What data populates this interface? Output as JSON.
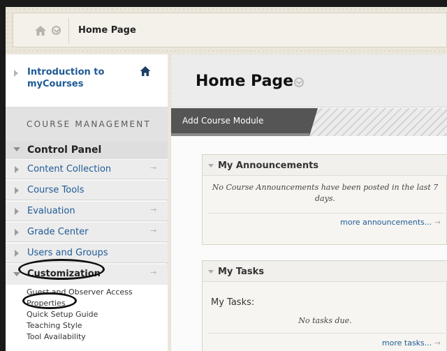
{
  "breadcrumb": {
    "current": "Home Page"
  },
  "menu": {
    "course_title": "Introduction to myCourses",
    "section_header": "COURSE MANAGEMENT",
    "control_panel": "Control Panel",
    "items": [
      {
        "label": "Content Collection",
        "arrow": "→"
      },
      {
        "label": "Course Tools",
        "arrow": ""
      },
      {
        "label": "Evaluation",
        "arrow": "→"
      },
      {
        "label": "Grade Center",
        "arrow": "→"
      },
      {
        "label": "Users and Groups",
        "arrow": ""
      }
    ],
    "customization": {
      "label": "Customization",
      "arrow": "→"
    },
    "sub_items": [
      "Guest and Observer Access",
      "Properties",
      "Quick Setup Guide",
      "Teaching Style",
      "Tool Availability"
    ]
  },
  "content": {
    "page_title": "Home Page",
    "add_module_label": "Add Course Module",
    "announcements": {
      "title": "My Announcements",
      "message": "No Course Announcements have been posted in the last 7 days.",
      "more_link": "more announcements...",
      "more_arrow": "→"
    },
    "tasks": {
      "title": "My Tasks",
      "label": "My Tasks:",
      "message": "No tasks due.",
      "more_link": "more tasks...",
      "more_arrow": "→"
    }
  },
  "colors": {
    "link": "#1e5a96",
    "annotation_oval": "#111111",
    "action_button": "#555555"
  },
  "icons": [
    "home-icon",
    "chevron-down-circle-icon",
    "expand-triangle-icon",
    "collapse-triangle-icon",
    "right-arrow-icon"
  ]
}
